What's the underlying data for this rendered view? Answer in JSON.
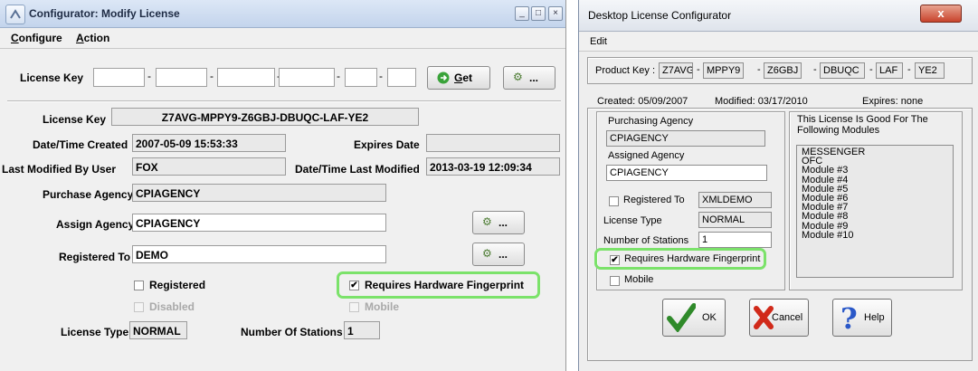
{
  "left_window": {
    "title": "Configurator: Modify License",
    "menu": {
      "configure_prefix": "C",
      "configure_rest": "onfigure",
      "action_prefix": "A",
      "action_rest": "ction"
    },
    "search": {
      "label": "License Key",
      "separator": "-",
      "get_prefix": "G",
      "get_rest": "et",
      "lookup_label": "..."
    },
    "details": {
      "license_key_label": "License Key",
      "license_key_value": "Z7AVG-MPPY9-Z6GBJ-DBUQC-LAF-YE2",
      "created_label": "Date/Time Created",
      "created_value": "2007-05-09 15:53:33",
      "expires_label": "Expires Date",
      "expires_value": "",
      "modified_by_label": "Last Modified By User",
      "modified_by_value": "FOX",
      "modified_label": "Date/Time Last Modified",
      "modified_value": "2013-03-19 12:09:34",
      "purchase_agency_label": "Purchase Agency",
      "purchase_agency_value": "CPIAGENCY",
      "assign_agency_label": "Assign Agency",
      "assign_agency_value": "CPIAGENCY",
      "registered_to_label": "Registered To",
      "registered_to_value": "DEMO",
      "lookup_label": "...",
      "registered_label": "Registered",
      "registered_checked": false,
      "fingerprint_label": "Requires Hardware Fingerprint",
      "fingerprint_checked": true,
      "disabled_label": "Disabled",
      "mobile_label": "Mobile",
      "license_type_label": "License Type",
      "license_type_value": "NORMAL",
      "stations_label": "Number Of Stations",
      "stations_value": "1"
    }
  },
  "right_window": {
    "title": "Desktop License Configurator",
    "close_glyph": "x",
    "menu_edit": "Edit",
    "product_key_label": "Product Key :",
    "key_segments": [
      "Z7AVG",
      "MPPY9",
      "Z6GBJ",
      "DBUQC",
      "LAF",
      "YE2"
    ],
    "separator": "-",
    "created": "Created:  05/09/2007",
    "modified": "Modified:  03/17/2010",
    "expires": "Expires:  none",
    "purchasing_agency_label": "Purchasing Agency",
    "purchasing_agency_value": "CPIAGENCY",
    "assigned_agency_label": "Assigned Agency",
    "assigned_agency_value": "CPIAGENCY",
    "registered_to_label": "Registered To",
    "registered_to_value": "XMLDEMO",
    "license_type_label": "License Type",
    "license_type_value": "NORMAL",
    "stations_label": "Number of Stations",
    "stations_value": "1",
    "fingerprint_label": "Requires Hardware Fingerprint",
    "fingerprint_checked": true,
    "mobile_label": "Mobile",
    "modules_header": "This License Is Good For The Following Modules",
    "modules": [
      "MESSENGER",
      "OFC",
      "Module #3",
      "Module #4",
      "Module #5",
      "Module #6",
      "Module #7",
      "Module #8",
      "Module #9",
      "Module #10"
    ],
    "ok_label": "OK",
    "cancel_label": "Cancel",
    "help_label": "Help"
  },
  "colors": {
    "highlight": "#7be26a",
    "title_left": "#c3d4ec",
    "panel_bg": "#f0f0f0"
  }
}
